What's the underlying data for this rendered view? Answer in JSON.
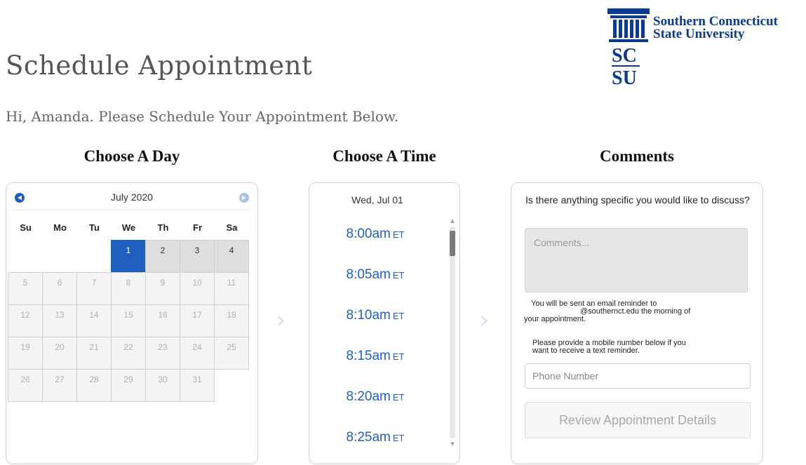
{
  "header": {
    "title": "Schedule Appointment",
    "greeting": "Hi, Amanda. Please Schedule Your Appointment Below.",
    "logo_text_line1": "Southern Connecticut",
    "logo_text_line2": "State University",
    "logo_mark_top": "SC",
    "logo_mark_bottom": "SU"
  },
  "sections": {
    "day": "Choose A Day",
    "time": "Choose A Time",
    "comments": "Comments"
  },
  "calendar": {
    "month_label": "July 2020",
    "prev_icon": "chevron-left-icon",
    "next_icon": "chevron-right-icon",
    "weekdays": [
      "Su",
      "Mo",
      "Tu",
      "We",
      "Th",
      "Fr",
      "Sa"
    ],
    "leading_blanks": 3,
    "days": [
      {
        "n": "1",
        "state": "selected"
      },
      {
        "n": "2",
        "state": "available"
      },
      {
        "n": "3",
        "state": "available"
      },
      {
        "n": "4",
        "state": "available"
      },
      {
        "n": "5",
        "state": "disabled"
      },
      {
        "n": "6",
        "state": "disabled"
      },
      {
        "n": "7",
        "state": "disabled"
      },
      {
        "n": "8",
        "state": "disabled"
      },
      {
        "n": "9",
        "state": "disabled"
      },
      {
        "n": "10",
        "state": "disabled"
      },
      {
        "n": "11",
        "state": "disabled"
      },
      {
        "n": "12",
        "state": "disabled"
      },
      {
        "n": "13",
        "state": "disabled"
      },
      {
        "n": "14",
        "state": "disabled"
      },
      {
        "n": "15",
        "state": "disabled"
      },
      {
        "n": "16",
        "state": "disabled"
      },
      {
        "n": "17",
        "state": "disabled"
      },
      {
        "n": "18",
        "state": "disabled"
      },
      {
        "n": "19",
        "state": "disabled"
      },
      {
        "n": "20",
        "state": "disabled"
      },
      {
        "n": "21",
        "state": "disabled"
      },
      {
        "n": "22",
        "state": "disabled"
      },
      {
        "n": "23",
        "state": "disabled"
      },
      {
        "n": "24",
        "state": "disabled"
      },
      {
        "n": "25",
        "state": "disabled"
      },
      {
        "n": "26",
        "state": "disabled"
      },
      {
        "n": "27",
        "state": "disabled"
      },
      {
        "n": "28",
        "state": "disabled"
      },
      {
        "n": "29",
        "state": "disabled"
      },
      {
        "n": "30",
        "state": "disabled"
      },
      {
        "n": "31",
        "state": "disabled"
      }
    ]
  },
  "times": {
    "date_label": "Wed, Jul 01",
    "slots": [
      {
        "time": "8:00am",
        "tz": "ET"
      },
      {
        "time": "8:05am",
        "tz": "ET"
      },
      {
        "time": "8:10am",
        "tz": "ET"
      },
      {
        "time": "8:15am",
        "tz": "ET"
      },
      {
        "time": "8:20am",
        "tz": "ET"
      },
      {
        "time": "8:25am",
        "tz": "ET"
      }
    ]
  },
  "comments": {
    "question": "Is there anything specific you would like to discuss?",
    "placeholder": "Comments...",
    "email_note_1": "You will be sent an email reminder to",
    "email_note_2": "@southernct.edu the morning of",
    "email_note_3": "your appointment.",
    "mobile_note_1": "Please provide a mobile number below if you",
    "mobile_note_2": "want to receive a text reminder.",
    "phone_placeholder": "Phone Number",
    "review_button": "Review Appointment Details"
  },
  "colors": {
    "accent": "#1f5fbf",
    "brand": "#0b3b8c"
  }
}
